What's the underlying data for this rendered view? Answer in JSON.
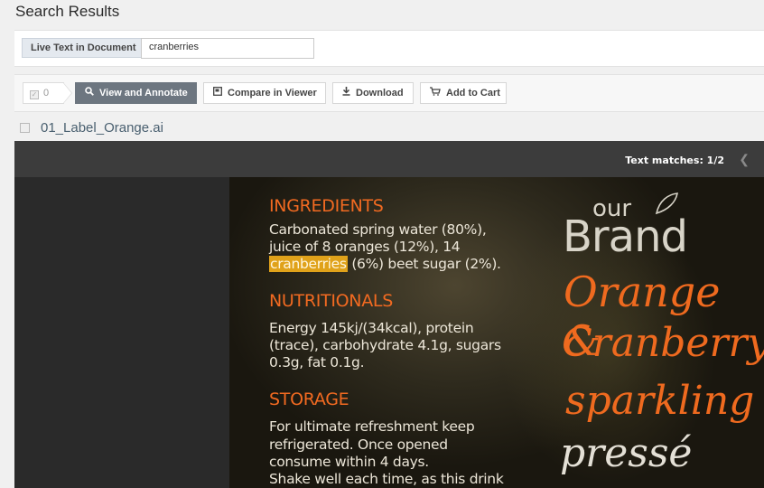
{
  "header": {
    "title": "Search Results"
  },
  "search": {
    "label": "Live Text in Document",
    "value": "cranberries"
  },
  "toolbar": {
    "selected_count": "0",
    "view_annotate": "View and Annotate",
    "compare": "Compare in Viewer",
    "download": "Download",
    "add_to_cart": "Add to Cart"
  },
  "result": {
    "file_name": "01_Label_Orange.ai"
  },
  "viewer": {
    "matches": "Text matches: 1/2"
  },
  "document": {
    "ingredients_heading": "INGREDIENTS",
    "ingredients_line1": "Carbonated spring water (80%),",
    "ingredients_line2": "juice of 8 oranges (12%), 14",
    "ingredients_highlight": "cranberries",
    "ingredients_line3_rest": " (6%) beet sugar (2%).",
    "nutritionals_heading": "NUTRITIONALS",
    "nutritionals_line1": "Energy 145kj/(34kcal), protein",
    "nutritionals_line2": "(trace), carbohydrate 4.1g, sugars",
    "nutritionals_line3": "0.3g, fat 0.1g.",
    "storage_heading": "STORAGE",
    "storage_line1": "For ultimate refreshment keep",
    "storage_line2": "refrigerated. Once opened",
    "storage_line3": "consume within 4 days.",
    "storage_line4": "Shake well each time, as this drink",
    "brand_our": "our",
    "brand_name": "Brand",
    "script_orange": "Orange &",
    "script_cranberry": "Cranberry",
    "script_sparkling": "sparkling",
    "script_presse": "pressé"
  },
  "colors": {
    "accent_orange": "#f26a21",
    "highlight": "#e0a21a",
    "primary_button": "#6d7680"
  }
}
